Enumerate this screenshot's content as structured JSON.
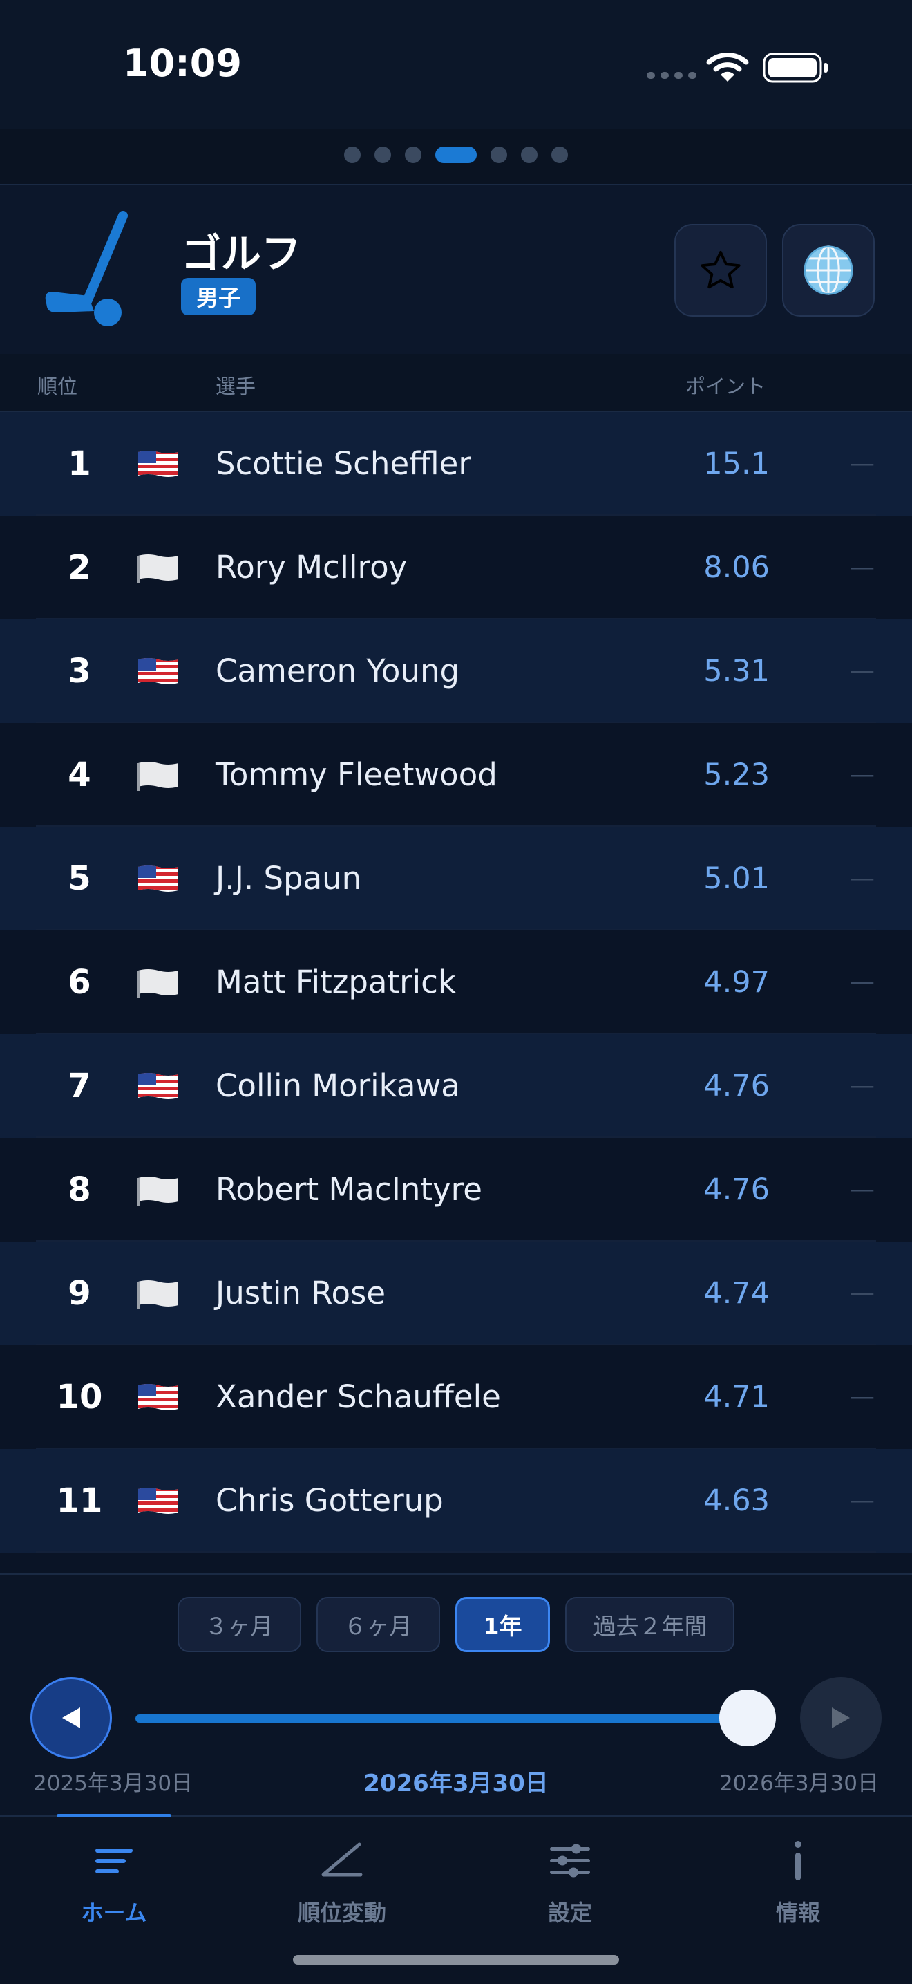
{
  "status": {
    "time": "10:09"
  },
  "pager": {
    "count": 7,
    "active": 3
  },
  "header": {
    "title": "ゴルフ",
    "badge": "男子",
    "logo_icon": "golf-club-icon",
    "favorite_icon": "star-icon",
    "globe_icon": "globe-icon"
  },
  "table": {
    "columns": {
      "rank": "順位",
      "player": "選手",
      "points": "ポイント"
    },
    "rows": [
      {
        "rank": "1",
        "flag": "us",
        "name": "Scottie Scheffler",
        "points": "15.1",
        "change": "—"
      },
      {
        "rank": "2",
        "flag": "white",
        "name": "Rory McIlroy",
        "points": "8.06",
        "change": "—"
      },
      {
        "rank": "3",
        "flag": "us",
        "name": "Cameron Young",
        "points": "5.31",
        "change": "—"
      },
      {
        "rank": "4",
        "flag": "white",
        "name": "Tommy Fleetwood",
        "points": "5.23",
        "change": "—"
      },
      {
        "rank": "5",
        "flag": "us",
        "name": "J.J. Spaun",
        "points": "5.01",
        "change": "—"
      },
      {
        "rank": "6",
        "flag": "white",
        "name": "Matt Fitzpatrick",
        "points": "4.97",
        "change": "—"
      },
      {
        "rank": "7",
        "flag": "us",
        "name": "Collin Morikawa",
        "points": "4.76",
        "change": "—"
      },
      {
        "rank": "8",
        "flag": "white",
        "name": "Robert MacIntyre",
        "points": "4.76",
        "change": "—"
      },
      {
        "rank": "9",
        "flag": "white",
        "name": "Justin Rose",
        "points": "4.74",
        "change": "—"
      },
      {
        "rank": "10",
        "flag": "us",
        "name": "Xander Schauffele",
        "points": "4.71",
        "change": "—"
      },
      {
        "rank": "11",
        "flag": "us",
        "name": "Chris Gotterup",
        "points": "4.63",
        "change": "—"
      }
    ]
  },
  "period": {
    "options": [
      "３ヶ月",
      "６ヶ月",
      "1年",
      "過去２年間"
    ],
    "selected": "1年",
    "start_date": "2025年3月30日",
    "current_date": "2026年3月30日",
    "end_date": "2026年3月30日",
    "slider_value": 1.0
  },
  "tabs": [
    {
      "label": "ホーム",
      "icon": "home-lines-icon",
      "active": true
    },
    {
      "label": "順位変動",
      "icon": "trend-line-icon",
      "active": false
    },
    {
      "label": "設定",
      "icon": "sliders-icon",
      "active": false
    },
    {
      "label": "情報",
      "icon": "info-icon",
      "active": false
    }
  ]
}
